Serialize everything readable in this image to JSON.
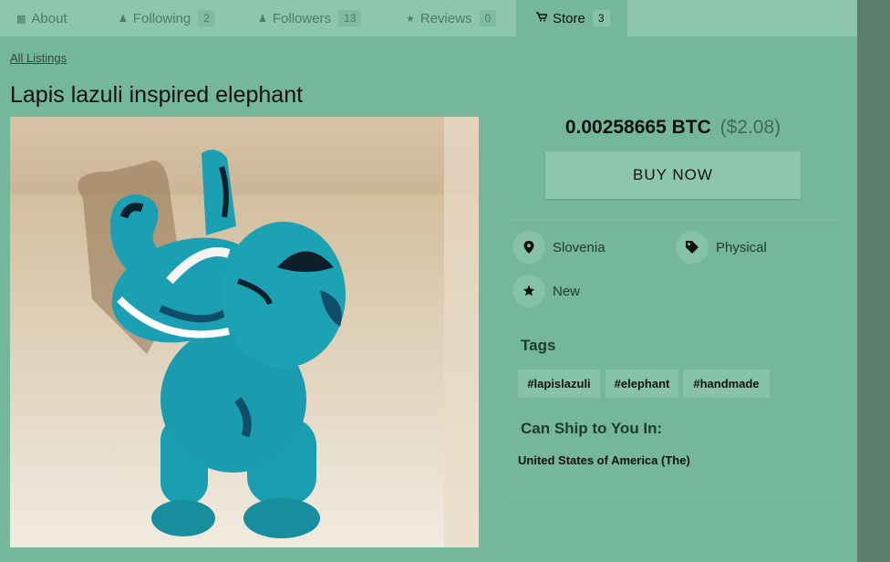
{
  "tabs": [
    {
      "label": "About",
      "count": ""
    },
    {
      "label": "Following",
      "count": "2"
    },
    {
      "label": "Followers",
      "count": "13"
    },
    {
      "label": "Reviews",
      "count": "0"
    },
    {
      "label": "Store",
      "count": "3"
    }
  ],
  "breadcrumb": {
    "all_listings": "All Listings"
  },
  "listing": {
    "title": "Lapis lazuli inspired elephant",
    "price_btc": "0.00258665 BTC",
    "price_usd": "($2.08)",
    "buy_label": "BUY NOW",
    "location": "Slovenia",
    "type": "Physical",
    "condition": "New",
    "tags_title": "Tags",
    "tags": [
      "#lapislazuli",
      "#elephant",
      "#handmade"
    ],
    "ship_title": "Can Ship to You In:",
    "ship_country": "United States of America (The)"
  },
  "colors": {
    "background": "#75b79b",
    "tab_bar": "#8cc6ad",
    "elephant": "#1a9fb0"
  },
  "icons": {
    "about": "book-icon",
    "following": "person-icon",
    "followers": "people-icon",
    "reviews": "star-icon",
    "store": "cart-icon",
    "location": "map-pin-icon",
    "type": "tag-icon",
    "condition": "star-icon"
  }
}
